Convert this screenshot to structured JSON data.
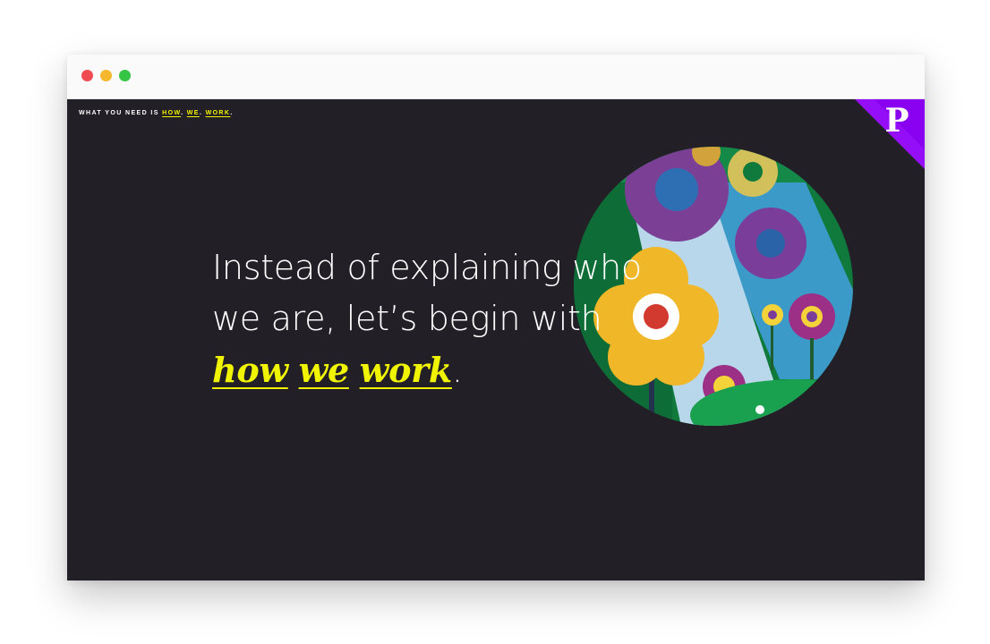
{
  "header": {
    "prefix": "WHAT YOU NEED IS ",
    "link1": "HOW",
    "sep1": ". ",
    "link2": "WE",
    "sep2": ". ",
    "link3": "WORK",
    "suffix": "."
  },
  "hero": {
    "line1": "Instead of explaining who",
    "line2": "we are, let’s begin with",
    "link1": "how",
    "link2": "we",
    "link3": "work",
    "end": "."
  },
  "brand": {
    "logo_letter": "P",
    "accent_color": "#8a00f0",
    "highlight_color": "#f1f400"
  },
  "icons": [
    "close-window-dot",
    "minimize-window-dot",
    "maximize-window-dot",
    "brand-logo-icon",
    "gears-flowers-illustration"
  ]
}
